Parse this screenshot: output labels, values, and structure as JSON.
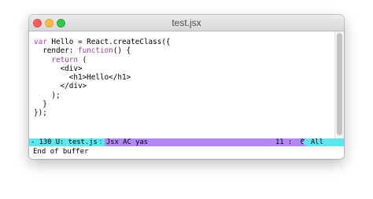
{
  "window": {
    "title": "test.jsx"
  },
  "editor": {
    "lines": [
      [
        {
          "t": "var",
          "c": "kw"
        },
        {
          "t": " Hello = React.createClass({",
          "c": ""
        }
      ],
      [
        {
          "t": "  render: ",
          "c": ""
        },
        {
          "t": "function",
          "c": "kw"
        },
        {
          "t": "() {",
          "c": ""
        }
      ],
      [
        {
          "t": "    ",
          "c": ""
        },
        {
          "t": "return",
          "c": "kw"
        },
        {
          "t": " (",
          "c": ""
        }
      ],
      [
        {
          "t": "      <div>",
          "c": ""
        }
      ],
      [
        {
          "t": "        <h1>Hello</h1>",
          "c": ""
        }
      ],
      [
        {
          "t": "      </div>",
          "c": ""
        }
      ],
      [
        {
          "t": "    );",
          "c": ""
        }
      ],
      [
        {
          "t": "  }",
          "c": ""
        }
      ],
      [
        {
          "t": "});",
          "c": ""
        }
      ]
    ]
  },
  "modeline": {
    "left": "- 130 U: test.jsx",
    "modes": "Jsx AC yas",
    "position": "11 :  0",
    "scroll": "All"
  },
  "echo_area": "End of buffer",
  "colors": {
    "keyword": "#a33eb0",
    "modeline_bg": "#b388f0",
    "modeline_accent": "#5ee6ee"
  }
}
